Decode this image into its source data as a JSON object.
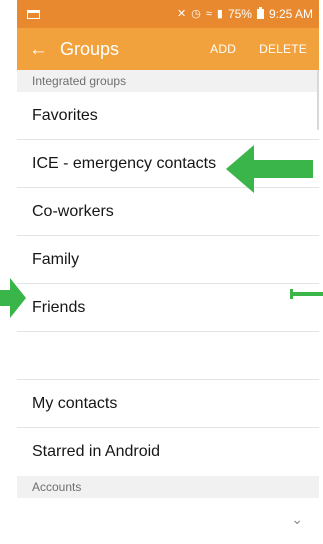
{
  "status": {
    "battery": "75%",
    "time": "9:25 AM"
  },
  "appbar": {
    "title": "Groups",
    "add": "ADD",
    "delete": "DELETE"
  },
  "sections": {
    "integrated": "Integrated groups",
    "accounts": "Accounts"
  },
  "groups": [
    "Favorites",
    "ICE - emergency contacts",
    "Co-workers",
    "Family",
    "Friends",
    "",
    "My contacts",
    "Starred in Android"
  ],
  "icons": {
    "back": "left-arrow-icon",
    "expand": "chevron-down-icon",
    "annotation": "green-arrow-icon"
  },
  "colors": {
    "status_bar": "#e8892f",
    "app_bar": "#f2a23d",
    "annotation": "#39b54a"
  }
}
